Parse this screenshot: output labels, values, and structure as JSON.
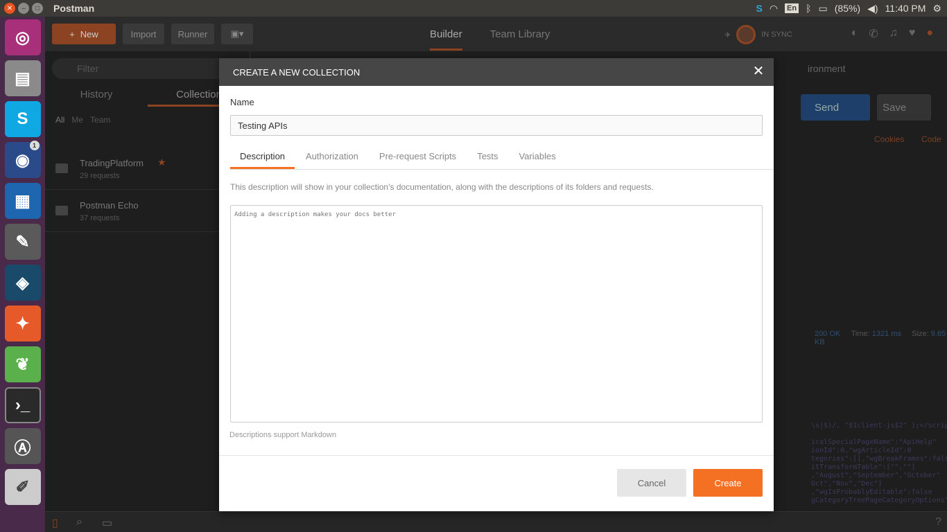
{
  "os": {
    "app_title": "Postman",
    "keyboard": "En",
    "battery": "(85%)",
    "clock": "11:40 PM",
    "launcher_badge": "1"
  },
  "header": {
    "new_label": "New",
    "import_label": "Import",
    "runner_label": "Runner",
    "tab_builder": "Builder",
    "tab_team_library": "Team Library",
    "sync_label": "IN SYNC"
  },
  "sidebar": {
    "filter_placeholder": "Filter",
    "tab_history": "History",
    "tab_collections": "Collection",
    "filter_all": "All",
    "filter_me": "Me",
    "filter_team": "Team",
    "collections": [
      {
        "name": "TradingPlatform",
        "count": "29 requests"
      },
      {
        "name": "Postman Echo",
        "count": "37 requests"
      }
    ]
  },
  "rightpane": {
    "environment": "ironment",
    "send_label": "Send",
    "save_label": "Save",
    "cookies_label": "Cookies",
    "code_label": "Code",
    "status_value": "200 OK",
    "time_label": "Time:",
    "time_value": "1321 ms",
    "size_label": "Size:",
    "size_value": "9.65 KB",
    "code_lines": "\\s|$)/, \"$1client-js$2\" );</script\n\nicalSpecialPageName\":\"ApiHelp\"\nionId\":0,\"wgArticleId\":0\ntegories\":[],\"wgBreakFrames\":false\nitTransformTable\":[\"\",\"\"]\n,\"August\",\"September\",\"October\"\nOct\",\"Nov\",\"Dec\"]\n,\"wgIsProbablyEditable\":false\ngCategoryTreePageCategoryOptions\""
  },
  "modal": {
    "title": "CREATE A NEW COLLECTION",
    "name_label": "Name",
    "name_value": "Testing APIs",
    "tabs": [
      "Description",
      "Authorization",
      "Pre-request Scripts",
      "Tests",
      "Variables"
    ],
    "description_help": "This description will show in your collection’s documentation, along with the descriptions of its folders and requests.",
    "description_placeholder": "Adding a description makes your docs better",
    "markdown_note": "Descriptions support Markdown",
    "cancel_label": "Cancel",
    "create_label": "Create"
  },
  "colors": {
    "accent": "#f47023",
    "modal_header": "#464646"
  }
}
